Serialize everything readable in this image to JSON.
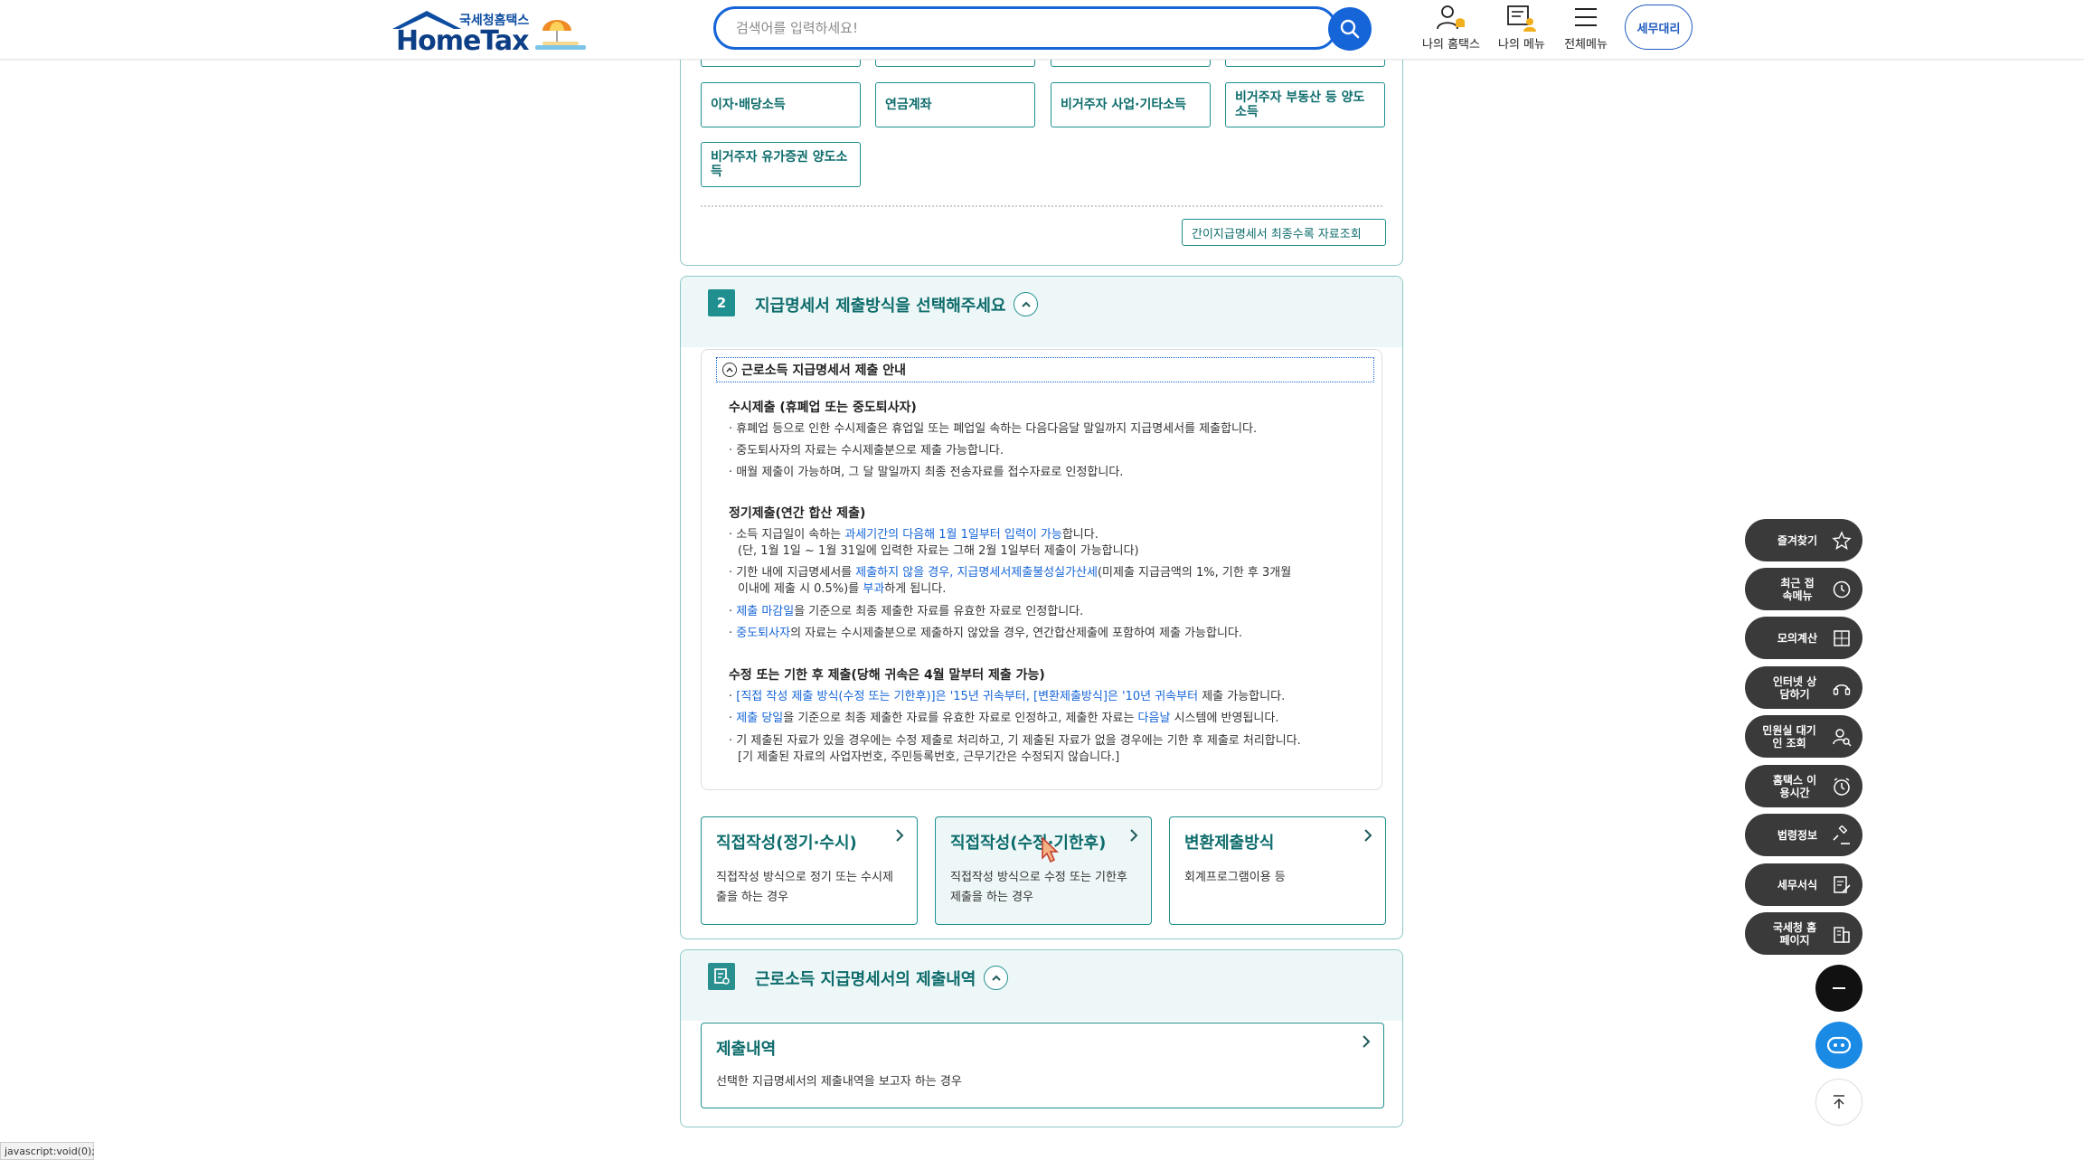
{
  "header": {
    "logo_small": "국세청홈택스",
    "logo_big": "HomeTax",
    "search_placeholder": "검색어를 입력하세요!",
    "nav": [
      {
        "label": "나의 홈택스",
        "icon": "user-bell-icon"
      },
      {
        "label": "나의 메뉴",
        "icon": "my-menu-icon"
      },
      {
        "label": "전체메뉴",
        "icon": "hamburger-icon"
      }
    ],
    "tax_agent": "세무대리"
  },
  "income_types": {
    "buttons": [
      "이자·배당소득",
      "연금계좌",
      "비거주자 사업·기타소득",
      "비거주자 부동산 등 양도소득",
      "비거주자 유가증권 양도소득"
    ],
    "lookup_button": "간이지급명세서 최종수록 자료조회"
  },
  "section2": {
    "number": "2",
    "title": "지급명세서 제출방식을 선택해주세요",
    "guide_title": "근로소득 지급명세서 제출 안내",
    "blocks": [
      {
        "heading": "수시제출 (휴폐업 또는 중도퇴사자)",
        "lines": [
          "· 휴폐업 등으로 인한 수시제출은 휴업일 또는 폐업일 속하는 다음다음달 말일까지 지급명세서를 제출합니다.",
          "· 중도퇴사자의 자료는 수시제출분으로 제출 가능합니다.",
          "· 매월 제출이 가능하며, 그 달 말일까지 최종 전송자료를 접수자료로 인정합니다."
        ]
      },
      {
        "heading": "정기제출(연간 합산 제출)",
        "lines": [
          {
            "a": "· 소득 지급일이 속하는 ",
            "b": "과세기간의 다음해 1월 1일부터 입력이 가능",
            "c": "합니다."
          },
          "(단, 1월 1일 ~ 1월 31일에 입력한 자료는 그해 2월 1일부터 제출이 가능합니다)",
          {
            "a": "· 기한 내에 지급명세서를 ",
            "b": "제출하지 않을 경우, 지급명세서제출불성실가산세",
            "c": "(미제출 지급금액의 1%, 기한 후 3개월"
          },
          {
            "a": "이내에 제출 시 0.5%)를 ",
            "b": "부과",
            "c": "하게 됩니다."
          },
          {
            "a": "· ",
            "b": "제출 마감일",
            "c": "을 기준으로 최종 제출한 자료를 유효한 자료로 인정합니다."
          },
          {
            "a": "· ",
            "b": "중도퇴사자",
            "c": "의 자료는 수시제출분으로 제출하지 않았을 경우, 연간합산제출에 포함하여 제출 가능합니다."
          }
        ]
      },
      {
        "heading": "수정 또는 기한 후 제출(당해 귀속은 4월 말부터 제출 가능)",
        "lines": [
          {
            "a": "· ",
            "b": "[직접 작성 제출 방식(수정 또는 기한후)]은 '15년 귀속부터, [변환제출방식]은 '10년 귀속부터",
            "c": " 제출 가능합니다."
          },
          {
            "a": "· ",
            "b": "제출 당일",
            "c": "을 기준으로 최종 제출한 자료를 유효한 자료로 인정하고, 제출한 자료는 ",
            "d": "다음날",
            "e": " 시스템에 반영됩니다."
          },
          "· 기 제출된 자료가 있을 경우에는 수정 제출로 처리하고, 기 제출된 자료가 없을 경우에는 기한 후 제출로 처리합니다.",
          "[기 제출된 자료의 사업자번호, 주민등록번호, 근무기간은 수정되지 않습니다.]"
        ]
      }
    ],
    "options": [
      {
        "title": "직접작성(정기·수시)",
        "desc": "직접작성 방식으로 정기 또는 수시제출을 하는 경우"
      },
      {
        "title": "직접작성(수정·기한후)",
        "desc": "직접작성 방식으로 수정 또는 기한후제출을 하는 경우"
      },
      {
        "title": "변환제출방식",
        "desc": "회계프로그램이용 등"
      }
    ]
  },
  "section3": {
    "title": "근로소득 지급명세서의 제출내역",
    "card_title": "제출내역",
    "card_desc": "선택한 지급명세서의 제출내역을 보고자 하는 경우"
  },
  "floating": [
    {
      "label": "즐겨찾기",
      "icon": "star-icon"
    },
    {
      "label": "최근 접속메뉴",
      "icon": "clock-icon"
    },
    {
      "label": "모의계산",
      "icon": "calculator-icon"
    },
    {
      "label": "인터넷 상담하기",
      "icon": "headset-icon"
    },
    {
      "label": "민원실 대기인 조회",
      "icon": "person-search-icon"
    },
    {
      "label": "홈택스 이용시간",
      "icon": "alarm-icon"
    },
    {
      "label": "법령정보",
      "icon": "gavel-icon"
    },
    {
      "label": "세무서식",
      "icon": "document-edit-icon"
    },
    {
      "label": "국세청 홈페이지",
      "icon": "building-icon"
    }
  ],
  "statusbar": "javascript:void(0);"
}
